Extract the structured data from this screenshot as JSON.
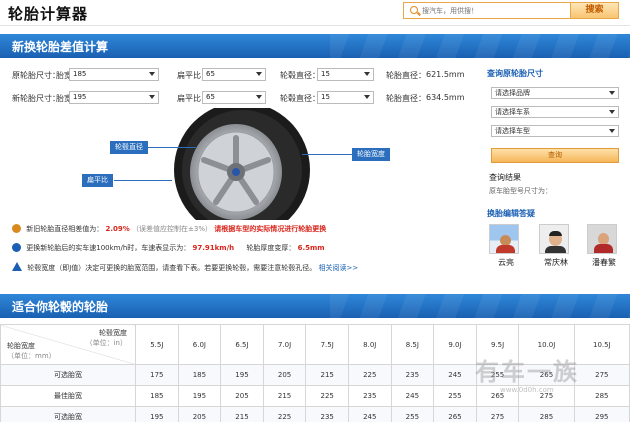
{
  "page": {
    "title": "轮胎计算器"
  },
  "search": {
    "placeholder": "搜汽车，用供搜！",
    "button": "搜索"
  },
  "calc": {
    "section_title": "新换轮胎差值计算",
    "row1": {
      "label": "原轮胎尺寸：",
      "width_label": "胎宽：",
      "width": "185",
      "ratio_label": "扁平比：",
      "ratio": "65",
      "rim_label": "轮毂直径：",
      "rim": "15",
      "diameter_label": "轮胎直径：",
      "diameter": "621.5mm"
    },
    "row2": {
      "label": "新轮胎尺寸：",
      "width_label": "胎宽：",
      "width": "195",
      "ratio_label": "扁平比：",
      "ratio": "65",
      "rim_label": "轮毂直径：",
      "rim": "15",
      "diameter_label": "轮胎直径：",
      "diameter": "634.5mm"
    },
    "labels": {
      "rim_diameter": "轮毂直径",
      "aspect_ratio": "扁平比",
      "tire_width": "轮胎宽度"
    },
    "info1": {
      "prefix": "新旧轮胎直径相差值为：",
      "value": "2.09%",
      "note": "（误差值应控制在±3%）",
      "warn": "请根据车型的实际情况进行轮胎更换"
    },
    "info2": {
      "prefix": "更换新轮胎后的实车速100km/h时，车速表显示为：",
      "speed": "97.91km/h",
      "thick_label": "轮胎厚度变厚：",
      "thick": "6.5mm"
    },
    "info3": {
      "text": "轮毂宽度（即J值）决定可更换的胎宽范围，请查看下表。若要更换轮毂，需要注意轮毂孔径。",
      "link": "相关阅读>>"
    }
  },
  "lookup": {
    "title": "查询原轮胎尺寸",
    "brand": "请选择品牌",
    "series": "请选择车系",
    "model": "请选择车型",
    "button": "查询",
    "result_title": "查询结果",
    "result_label": "原车胎型号尺寸为："
  },
  "experts": {
    "title": "换胎编辑答疑",
    "names": [
      "云亮",
      "常庆林",
      "潘春繁"
    ]
  },
  "fit": {
    "section_title": "适合你轮毂的轮胎"
  },
  "table": {
    "corner_top": "轮毂宽度",
    "corner_top_unit": "（单位：in）",
    "corner_bottom": "轮胎宽度",
    "corner_bottom_unit": "（单位：mm）",
    "columns": [
      "5.5J",
      "6.0J",
      "6.5J",
      "7.0J",
      "7.5J",
      "8.0J",
      "8.5J",
      "9.0J",
      "9.5J",
      "10.0J",
      "10.5J"
    ],
    "rows": [
      {
        "label": "可选胎宽",
        "values": [
          "175",
          "185",
          "195",
          "205",
          "215",
          "225",
          "235",
          "245",
          "255",
          "265",
          "275"
        ]
      },
      {
        "label": "最佳胎宽",
        "values": [
          "185",
          "195",
          "205",
          "215",
          "225",
          "235",
          "245",
          "255",
          "265",
          "275",
          "285"
        ]
      },
      {
        "label": "可选胎宽",
        "values": [
          "195",
          "205",
          "215",
          "225",
          "235",
          "245",
          "255",
          "265",
          "275",
          "285",
          "295"
        ]
      }
    ]
  },
  "watermark": {
    "text": "有车一族",
    "url": "www.0d0h.com"
  },
  "colors": {
    "accent": "#1a60b2",
    "warn": "#d9261c",
    "button": "#f8c471"
  }
}
